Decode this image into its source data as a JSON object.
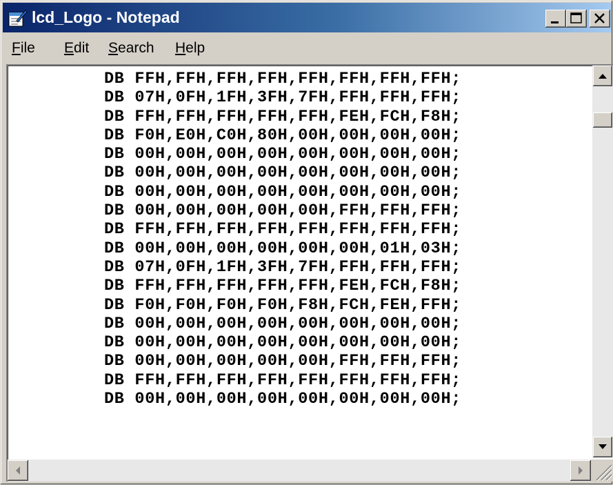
{
  "window": {
    "title": "lcd_Logo - Notepad"
  },
  "titlebar_buttons": {
    "minimize_icon": "minimize-icon",
    "maximize_icon": "maximize-icon",
    "close_icon": "close-icon"
  },
  "menu": {
    "items": [
      {
        "accel": "F",
        "rest": "ile"
      },
      {
        "accel": "E",
        "rest": "dit"
      },
      {
        "accel": "S",
        "rest": "earch"
      },
      {
        "accel": "H",
        "rest": "elp"
      }
    ]
  },
  "editor": {
    "text": "DB FFH,FFH,FFH,FFH,FFH,FFH,FFH,FFH;\nDB 07H,0FH,1FH,3FH,7FH,FFH,FFH,FFH;\nDB FFH,FFH,FFH,FFH,FFH,FEH,FCH,F8H;\nDB F0H,E0H,C0H,80H,00H,00H,00H,00H;\nDB 00H,00H,00H,00H,00H,00H,00H,00H;\nDB 00H,00H,00H,00H,00H,00H,00H,00H;\nDB 00H,00H,00H,00H,00H,00H,00H,00H;\nDB 00H,00H,00H,00H,00H,FFH,FFH,FFH;\nDB FFH,FFH,FFH,FFH,FFH,FFH,FFH,FFH;\nDB 00H,00H,00H,00H,00H,00H,01H,03H;\nDB 07H,0FH,1FH,3FH,7FH,FFH,FFH,FFH;\nDB FFH,FFH,FFH,FFH,FFH,FEH,FCH,F8H;\nDB F0H,F0H,F0H,F0H,F8H,FCH,FEH,FFH;\nDB 00H,00H,00H,00H,00H,00H,00H,00H;\nDB 00H,00H,00H,00H,00H,00H,00H,00H;\nDB 00H,00H,00H,00H,00H,FFH,FFH,FFH;\nDB FFH,FFH,FFH,FFH,FFH,FFH,FFH,FFH;\nDB 00H,00H,00H,00H,00H,00H,00H,00H;"
  },
  "colors": {
    "titlebar_start": "#0a246a",
    "titlebar_end": "#a6caf0",
    "chrome": "#d4d0c8"
  }
}
